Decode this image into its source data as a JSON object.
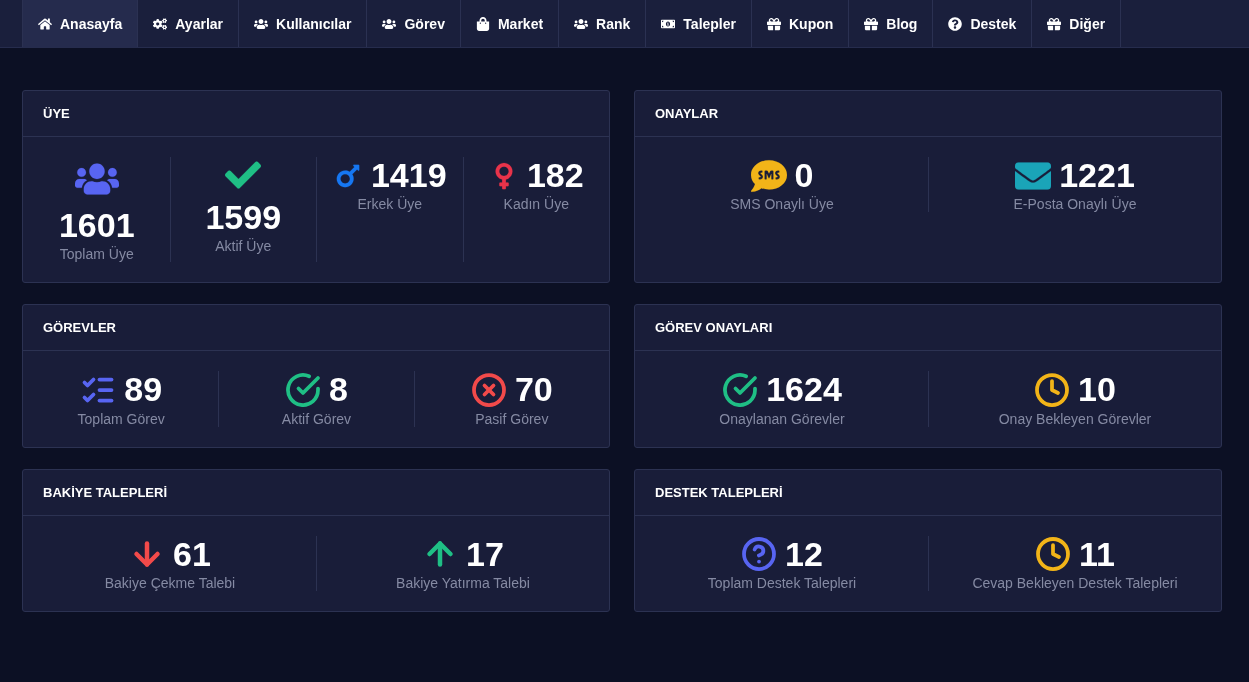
{
  "nav": [
    {
      "label": "Anasayfa",
      "selected": true
    },
    {
      "label": "Ayarlar",
      "selected": false
    },
    {
      "label": "Kullanıcılar",
      "selected": false
    },
    {
      "label": "Görev",
      "selected": false
    },
    {
      "label": "Market",
      "selected": false
    },
    {
      "label": "Rank",
      "selected": false
    },
    {
      "label": "Talepler",
      "selected": false
    },
    {
      "label": "Kupon",
      "selected": false
    },
    {
      "label": "Blog",
      "selected": false
    },
    {
      "label": "Destek",
      "selected": false
    },
    {
      "label": "Diğer",
      "selected": false
    }
  ],
  "cards": [
    {
      "title": "ÜYE",
      "stats": [
        {
          "value": "1601",
          "label": "Toplam Üye"
        },
        {
          "value": "1599",
          "label": "Aktif Üye"
        },
        {
          "value": "1419",
          "label": "Erkek Üye"
        },
        {
          "value": "182",
          "label": "Kadın Üye"
        }
      ]
    },
    {
      "title": "ONAYLAR",
      "stats": [
        {
          "value": "0",
          "label": "SMS Onaylı Üye"
        },
        {
          "value": "1221",
          "label": "E-Posta Onaylı Üye"
        }
      ]
    },
    {
      "title": "GÖREVLER",
      "stats": [
        {
          "value": "89",
          "label": "Toplam Görev"
        },
        {
          "value": "8",
          "label": "Aktif Görev"
        },
        {
          "value": "70",
          "label": "Pasif Görev"
        }
      ]
    },
    {
      "title": "GÖREV ONAYLARI",
      "stats": [
        {
          "value": "1624",
          "label": "Onaylanan Görevler"
        },
        {
          "value": "10",
          "label": "Onay Bekleyen Görevler"
        }
      ]
    },
    {
      "title": "BAKİYE TALEPLERİ",
      "stats": [
        {
          "value": "61",
          "label": "Bakiye Çekme Talebi"
        },
        {
          "value": "17",
          "label": "Bakiye Yatırma Talebi"
        }
      ]
    },
    {
      "title": "DESTEK TALEPLERİ",
      "stats": [
        {
          "value": "12",
          "label": "Toplam Destek Talepleri"
        },
        {
          "value": "11",
          "label": "Cevap Bekleyen Destek Talepleri"
        }
      ]
    }
  ]
}
